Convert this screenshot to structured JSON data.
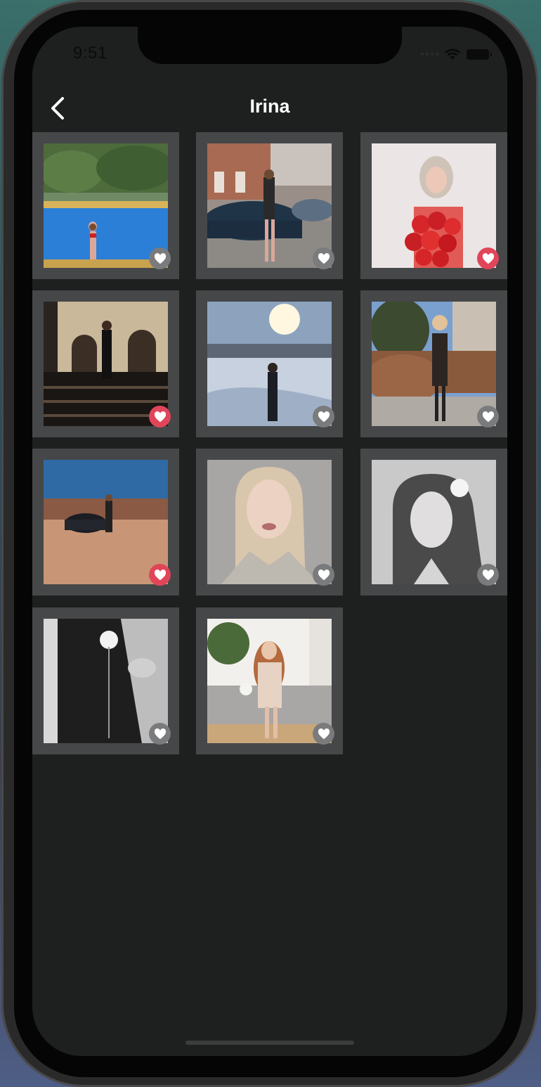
{
  "status_bar": {
    "time": "9:51"
  },
  "nav": {
    "title": "Irina"
  },
  "icons": {
    "back": "chevron-left-icon",
    "like": "heart-icon",
    "wifi": "wifi-icon",
    "battery": "battery-icon"
  },
  "colors": {
    "background": "#1e1f1f",
    "tile": "#464748",
    "like_on": "#e0455a",
    "like_off": "#7a7b7c"
  },
  "photos": [
    {
      "scene": "pool",
      "liked": false
    },
    {
      "scene": "car-street",
      "liked": false
    },
    {
      "scene": "roses",
      "liked": true
    },
    {
      "scene": "building-steps",
      "liked": true
    },
    {
      "scene": "snowy-sunlight",
      "liked": false
    },
    {
      "scene": "autumn-street",
      "liked": false
    },
    {
      "scene": "car-blue-sky",
      "liked": true
    },
    {
      "scene": "portrait-blonde",
      "liked": false
    },
    {
      "scene": "portrait-bw-flower",
      "liked": false
    },
    {
      "scene": "bw-dress-flower",
      "liked": false
    },
    {
      "scene": "sofa-dress",
      "liked": false
    }
  ]
}
